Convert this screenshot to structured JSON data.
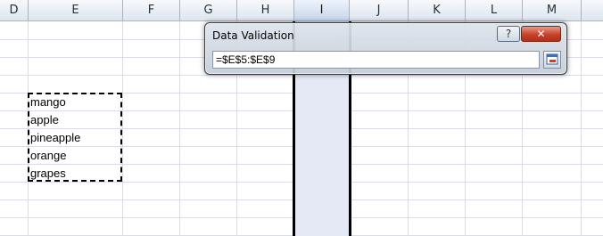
{
  "sheet": {
    "columns": [
      {
        "label": "D",
        "selected": false
      },
      {
        "label": "E",
        "selected": false
      },
      {
        "label": "F",
        "selected": false
      },
      {
        "label": "G",
        "selected": false
      },
      {
        "label": "H",
        "selected": false
      },
      {
        "label": "I",
        "selected": true
      },
      {
        "label": "J",
        "selected": false
      },
      {
        "label": "K",
        "selected": false
      },
      {
        "label": "L",
        "selected": false
      },
      {
        "label": "M",
        "selected": false
      }
    ],
    "cells": [
      "mango",
      "apple",
      "pineapple",
      "orange",
      "grapes"
    ]
  },
  "dialog": {
    "title": "Data Validation",
    "help_label": "?",
    "close_label": "✕",
    "reference": "=$E$5:$E$9",
    "expand_icon": "collapse-dialog-icon"
  },
  "colors": {
    "selected_column": "#e5e9f5",
    "gridline": "#d9dee6",
    "close_button": "#c7422a"
  }
}
